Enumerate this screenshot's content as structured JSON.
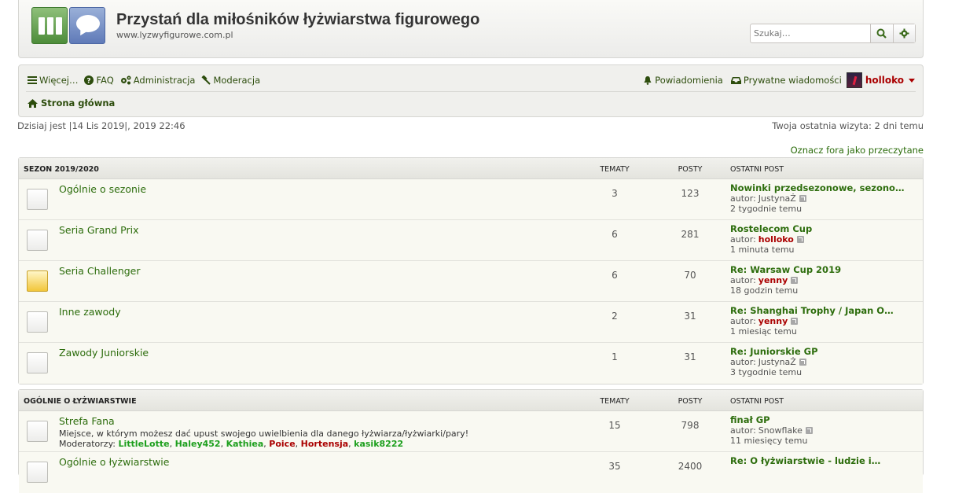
{
  "site": {
    "title": "Przystań dla miłośników łyżwiarstwa figurowego",
    "url": "www.lyzwyfigurowe.com.pl"
  },
  "search": {
    "placeholder": "Szukaj…"
  },
  "nav": {
    "more": "Więcej…",
    "faq": "FAQ",
    "admin": "Administracja",
    "moderation": "Moderacja",
    "notifications": "Powiadomienia",
    "pm": "Prywatne wiadomości",
    "username": "holloko",
    "breadcrumb_home": "Strona główna"
  },
  "info": {
    "date": "Dzisiaj jest |14 Lis 2019|, 2019 22:46",
    "last_visit": "Twoja ostatnia wizyta: 2 dni temu",
    "mark_read": "Oznacz fora jako przeczytane"
  },
  "colors": {
    "link_green": "#2d6d0d",
    "user_red": "#aa0000",
    "mod_green": "#1d9f1d"
  },
  "categories": [
    {
      "title": "SEZON 2019/2020",
      "col_topics": "TEMATY",
      "col_posts": "POSTY",
      "col_last": "OSTATNI POST",
      "forums": [
        {
          "name": "Ogólnie o sezonie",
          "topics": "3",
          "posts": "123",
          "last_title": "Nowinki przedsezonowe, sezono…",
          "author_prefix": "autor:",
          "author": "JustynaŻ",
          "author_red": false,
          "time": "2 tygodnie temu",
          "unread": false
        },
        {
          "name": "Seria Grand Prix",
          "topics": "6",
          "posts": "281",
          "last_title": "Rostelecom Cup",
          "author_prefix": "autor:",
          "author": "holloko",
          "author_red": true,
          "time": "1 minuta temu",
          "unread": false
        },
        {
          "name": "Seria Challenger",
          "topics": "6",
          "posts": "70",
          "last_title": "Re: Warsaw Cup 2019",
          "author_prefix": "autor:",
          "author": "yenny",
          "author_red": true,
          "time": "18 godzin temu",
          "unread": true
        },
        {
          "name": "Inne zawody",
          "topics": "2",
          "posts": "31",
          "last_title": "Re: Shanghai Trophy / Japan O…",
          "author_prefix": "autor:",
          "author": "yenny",
          "author_red": true,
          "time": "1 miesiąc temu",
          "unread": false
        },
        {
          "name": "Zawody Juniorskie",
          "topics": "1",
          "posts": "31",
          "last_title": "Re: Juniorskie GP",
          "author_prefix": "autor:",
          "author": "JustynaŻ",
          "author_red": false,
          "time": "3 tygodnie temu",
          "unread": false
        }
      ]
    },
    {
      "title": "OGÓLNIE O ŁYŻWIARSTWIE",
      "col_topics": "TEMATY",
      "col_posts": "POSTY",
      "col_last": "OSTATNI POST",
      "forums": [
        {
          "name": "Strefa Fana",
          "desc": "Miejsce, w którym możesz dać upust swojego uwielbienia dla danego łyżwiarza/łyżwiarki/pary!",
          "mods_label": "Moderatorzy:",
          "mods": [
            {
              "name": "LittleLotte",
              "color": "#1d9f1d"
            },
            {
              "name": "Haley452",
              "color": "#1d9f1d"
            },
            {
              "name": "Kathiea",
              "color": "#1d9f1d"
            },
            {
              "name": "Poice",
              "color": "#aa0000"
            },
            {
              "name": "Hortensja",
              "color": "#aa0000"
            },
            {
              "name": "kasik8222",
              "color": "#1d9f1d"
            }
          ],
          "topics": "15",
          "posts": "798",
          "last_title": "finał GP",
          "author_prefix": "autor:",
          "author": "Snowflake",
          "author_red": false,
          "time": "11 miesięcy temu",
          "unread": false
        },
        {
          "name": "Ogólnie o łyżwiarstwie",
          "topics": "35",
          "posts": "2400",
          "last_title": "Re: O łyżwiarstwie - ludzie i…",
          "author_prefix": "autor:",
          "author": "",
          "author_red": false,
          "time": "",
          "unread": false
        }
      ]
    }
  ]
}
